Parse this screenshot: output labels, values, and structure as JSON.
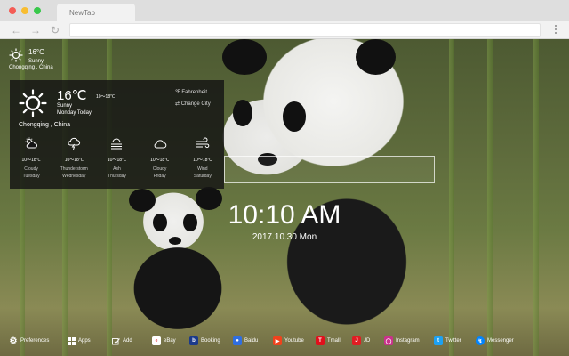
{
  "browser": {
    "tab_title": "NewTab"
  },
  "mini_weather": {
    "temp": "16°C",
    "condition": "Sunny",
    "location": "Chongqing , China"
  },
  "weather": {
    "temp": "16℃",
    "range": "10～18℃",
    "condition": "Sunny",
    "day": "Monday Today",
    "unit_toggle": "℉ Fahrenheit",
    "change_city": "⇄ Change City",
    "location": "Chongqing , China",
    "forecast": [
      {
        "icon": "cloudy-sun-icon",
        "range": "10～18℃",
        "condition": "Cloudy",
        "day": "Tuesday"
      },
      {
        "icon": "thunderstorm-icon",
        "range": "10～18℃",
        "condition": "Thunderstorm",
        "day": "Wednesday"
      },
      {
        "icon": "ash-icon",
        "range": "10～18℃",
        "condition": "Ash",
        "day": "Thursday"
      },
      {
        "icon": "cloud-icon",
        "range": "10～18℃",
        "condition": "Cloudy",
        "day": "Friday"
      },
      {
        "icon": "wind-icon",
        "range": "10～18℃",
        "condition": "Wind",
        "day": "Saturday"
      }
    ]
  },
  "clock": {
    "time": "10:10 AM",
    "date": "2017.10.30 Mon"
  },
  "shortcuts": [
    {
      "label": "Preferences",
      "icon": "gear-icon",
      "color": "#555555"
    },
    {
      "label": "Apps",
      "icon": "apps-grid-icon",
      "color": "#555555"
    },
    {
      "label": "Add",
      "icon": "add-icon",
      "color": "#555555"
    },
    {
      "label": "eBay",
      "icon": "ebay-icon",
      "color": "#ffffff"
    },
    {
      "label": "Booking",
      "icon": "booking-icon",
      "color": "#1b3a8a"
    },
    {
      "label": "Baidu",
      "icon": "baidu-icon",
      "color": "#2f6ee0"
    },
    {
      "label": "Youtube",
      "icon": "youtube-icon",
      "color": "#f0421c"
    },
    {
      "label": "Tmall",
      "icon": "tmall-icon",
      "color": "#e0101c"
    },
    {
      "label": "JD",
      "icon": "jd-icon",
      "color": "#e11d23"
    },
    {
      "label": "Instagram",
      "icon": "instagram-icon",
      "color": "#c9318b"
    },
    {
      "label": "Twitter",
      "icon": "twitter-icon",
      "color": "#1da1f2"
    },
    {
      "label": "Messenger",
      "icon": "messenger-icon",
      "color": "#0084ff"
    }
  ]
}
